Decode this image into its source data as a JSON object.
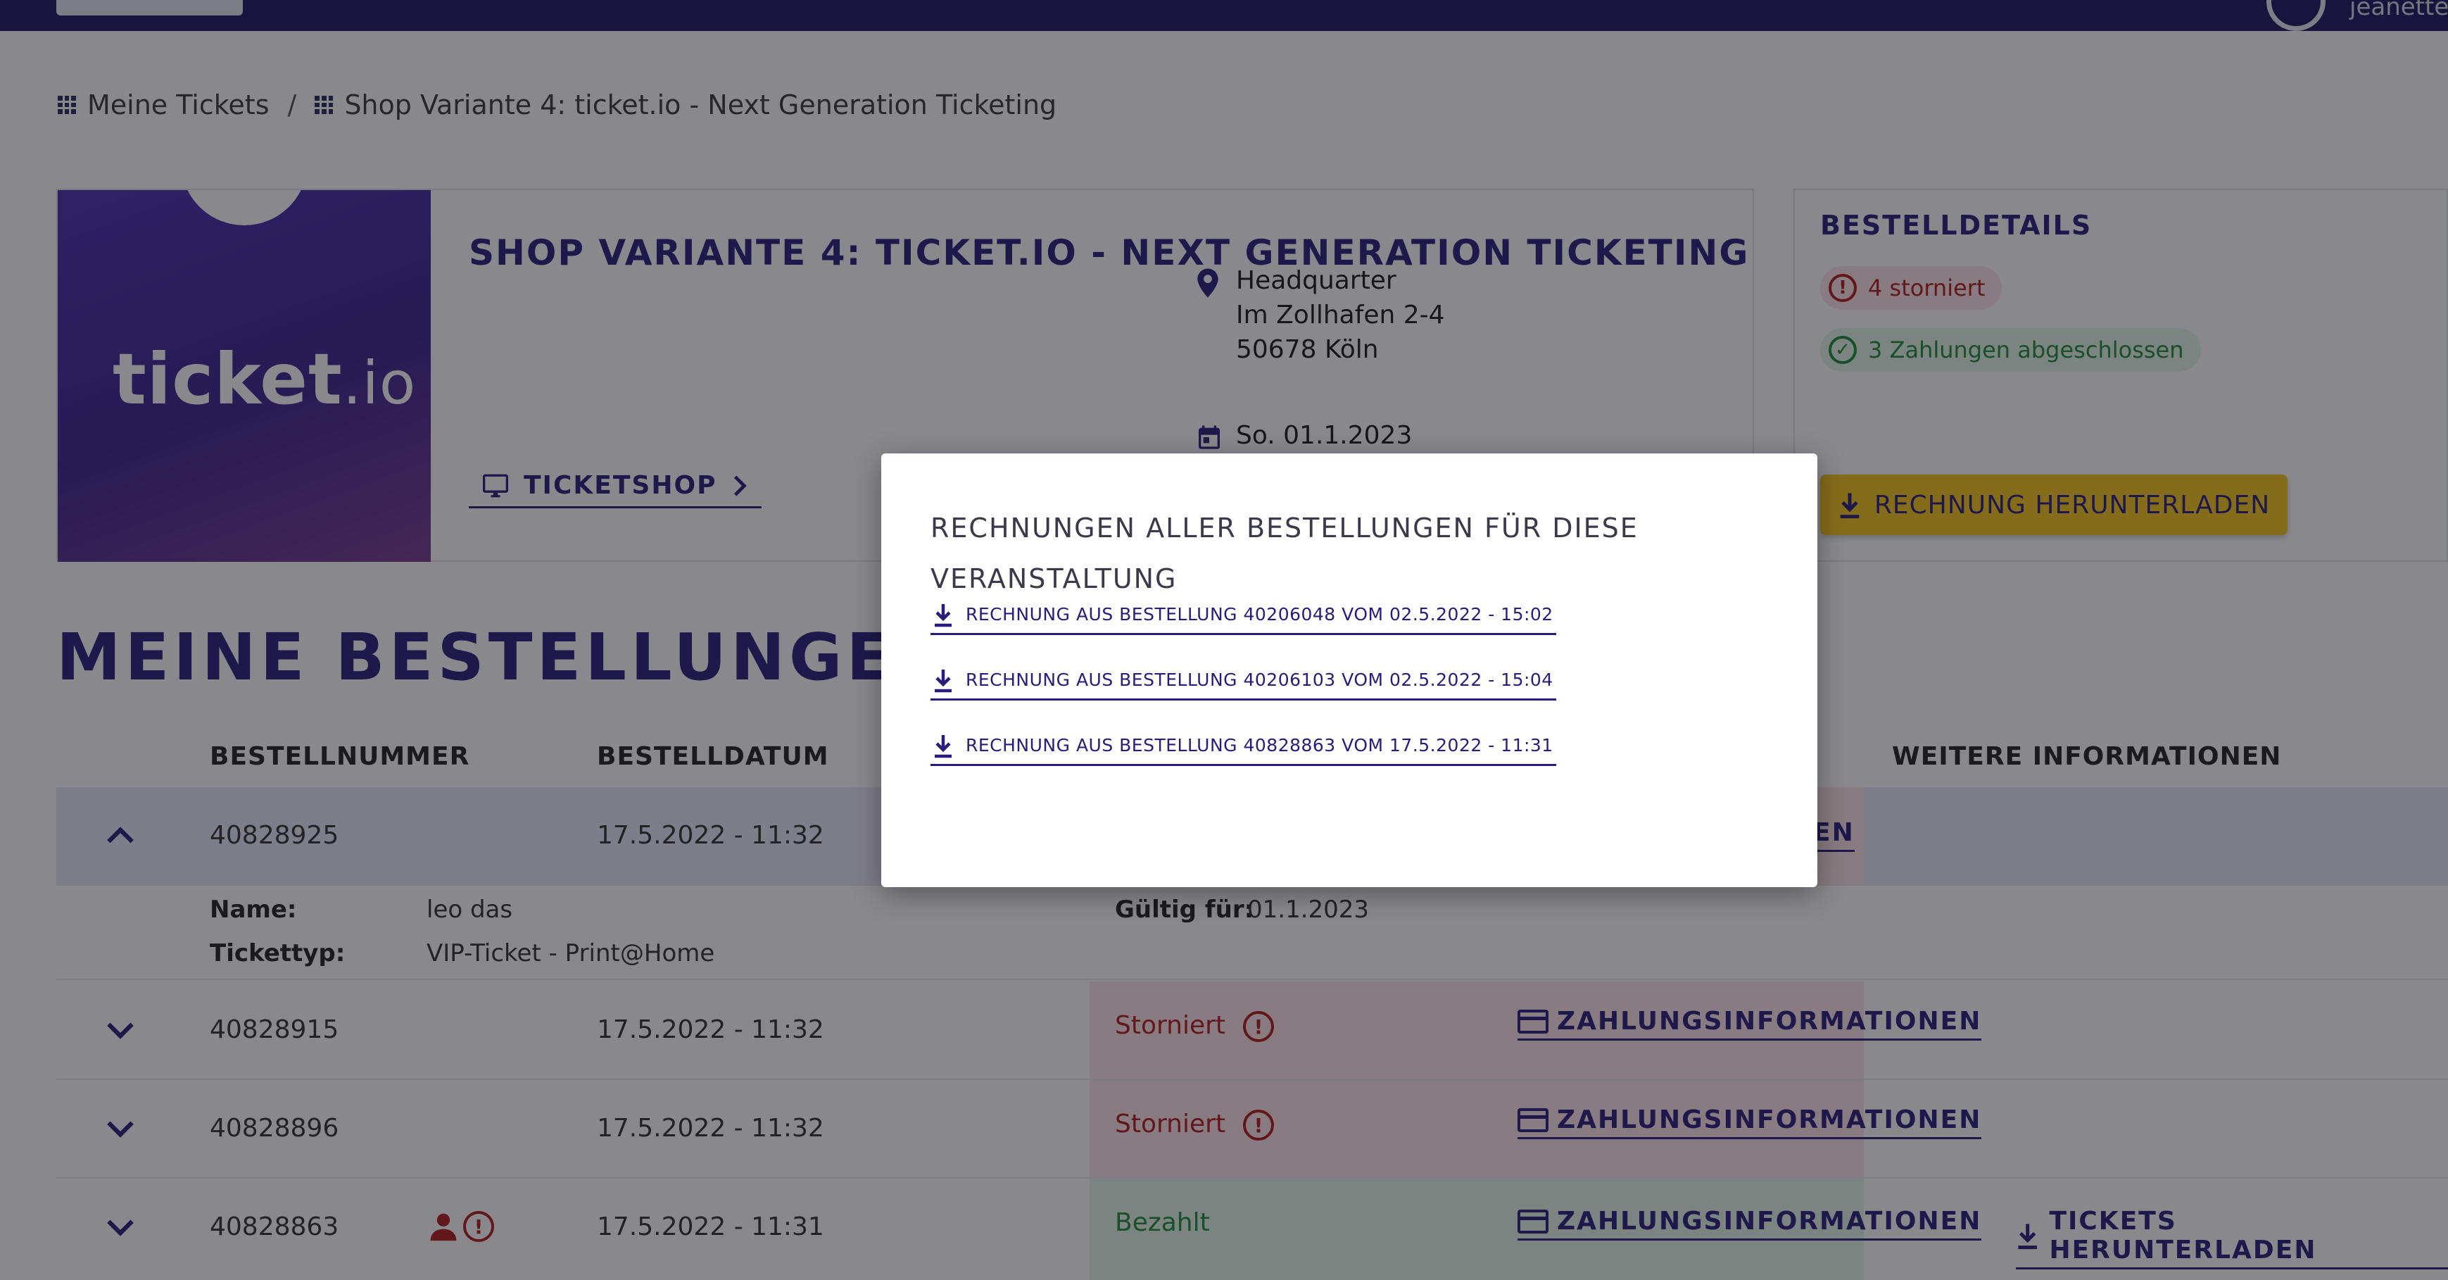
{
  "header": {
    "user_name": "jeanette"
  },
  "breadcrumb": {
    "home": "Meine Tickets",
    "separator": "/",
    "current": "Shop Variante 4: ticket.io - Next Generation Ticketing"
  },
  "event": {
    "logo_text": "ticket",
    "logo_suffix": ".io",
    "title": "SHOP VARIANTE 4: TICKET.IO - NEXT GENERATION TICKETING",
    "address_line1": "Headquarter",
    "address_line2": "Im Zollhafen 2-4",
    "address_line3": "50678 Köln",
    "date": "So. 01.1.2023",
    "ticketshop_label": "TICKETSHOP"
  },
  "details": {
    "title": "BESTELLDETAILS",
    "cancelled_badge": "4 storniert",
    "payments_badge": "3 Zahlungen abgeschlossen",
    "download_invoice": "RECHNUNG HERUNTERLADEN"
  },
  "orders": {
    "title": "MEINE BESTELLUNGEN",
    "columns": {
      "number": "BESTELLNUMMER",
      "date": "BESTELLDATUM",
      "more": "WEITERE INFORMATIONEN"
    },
    "rows": [
      {
        "number": "40828925",
        "date": "17.5.2022 - 11:32",
        "link_fragment": "EN"
      },
      {
        "number": "40828915",
        "date": "17.5.2022 - 11:32",
        "status": "Storniert",
        "payment_link": "ZAHLUNGSINFORMATIONEN"
      },
      {
        "number": "40828896",
        "date": "17.5.2022 - 11:32",
        "status": "Storniert",
        "payment_link": "ZAHLUNGSINFORMATIONEN"
      },
      {
        "number": "40828863",
        "date": "17.5.2022 - 11:31",
        "status": "Bezahlt",
        "payment_link": "ZAHLUNGSINFORMATIONEN",
        "download_link": "TICKETS HERUNTERLADEN"
      }
    ],
    "expanded": {
      "name_label": "Name:",
      "name_value": "leo das",
      "type_label": "Tickettyp:",
      "type_value": "VIP-Ticket - Print@Home",
      "valid_label": "Gültig für:",
      "valid_value": "01.1.2023"
    }
  },
  "modal": {
    "title": "RECHNUNGEN ALLER BESTELLUNGEN FÜR DIESE VERANSTALTUNG",
    "links": [
      "RECHNUNG AUS BESTELLUNG 40206048 VOM 02.5.2022 - 15:02",
      "RECHNUNG AUS BESTELLUNG 40206103 VOM 02.5.2022 - 15:04",
      "RECHNUNG AUS BESTELLUNG 40828863 VOM 17.5.2022 - 11:31"
    ]
  },
  "colors": {
    "brand": "#2a1c7a",
    "accent_yellow": "#f7c51a",
    "danger": "#b11a1a",
    "success": "#1f8a3a",
    "cancelled_bg": "#fde3e6",
    "paid_bg": "#e2f4e6",
    "expanded_row_bg": "#e9e6f8"
  }
}
